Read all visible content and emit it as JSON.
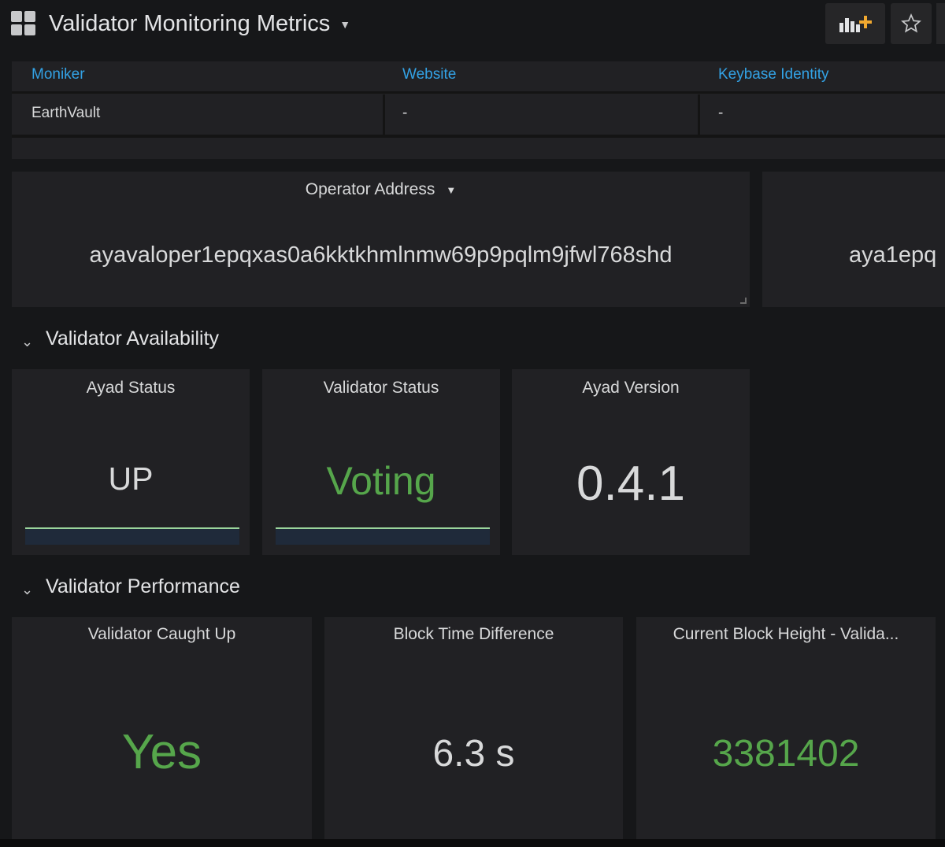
{
  "header": {
    "title": "Validator Monitoring Metrics",
    "add_panel_icon": "add-panel-icon",
    "star_icon": "star-icon"
  },
  "info_table": {
    "columns": [
      "Moniker",
      "Website",
      "Keybase Identity"
    ],
    "rows": [
      [
        "EarthVault",
        "-",
        "-"
      ]
    ]
  },
  "operator_panel": {
    "title": "Operator Address",
    "value": "ayavaloper1epqxas0a6kktkhmlnmw69p9pqlm9jfwl768shd"
  },
  "account_panel": {
    "value": "aya1epq"
  },
  "sections": {
    "availability": "Validator Availability",
    "performance": "Validator Performance"
  },
  "availability_panels": [
    {
      "title": "Ayad Status",
      "value": "UP"
    },
    {
      "title": "Validator Status",
      "value": "Voting"
    },
    {
      "title": "Ayad Version",
      "value": "0.4.1"
    }
  ],
  "performance_panels": [
    {
      "title": "Validator Caught Up",
      "value": "Yes"
    },
    {
      "title": "Block Time Difference",
      "value": "6.3 s"
    },
    {
      "title": "Current Block Height - Valida...",
      "value": "3381402"
    }
  ],
  "colors": {
    "background": "#161719",
    "panel": "#212124",
    "link_blue": "#33a2e5",
    "status_green": "#56a64b",
    "text": "#d8d9da"
  }
}
